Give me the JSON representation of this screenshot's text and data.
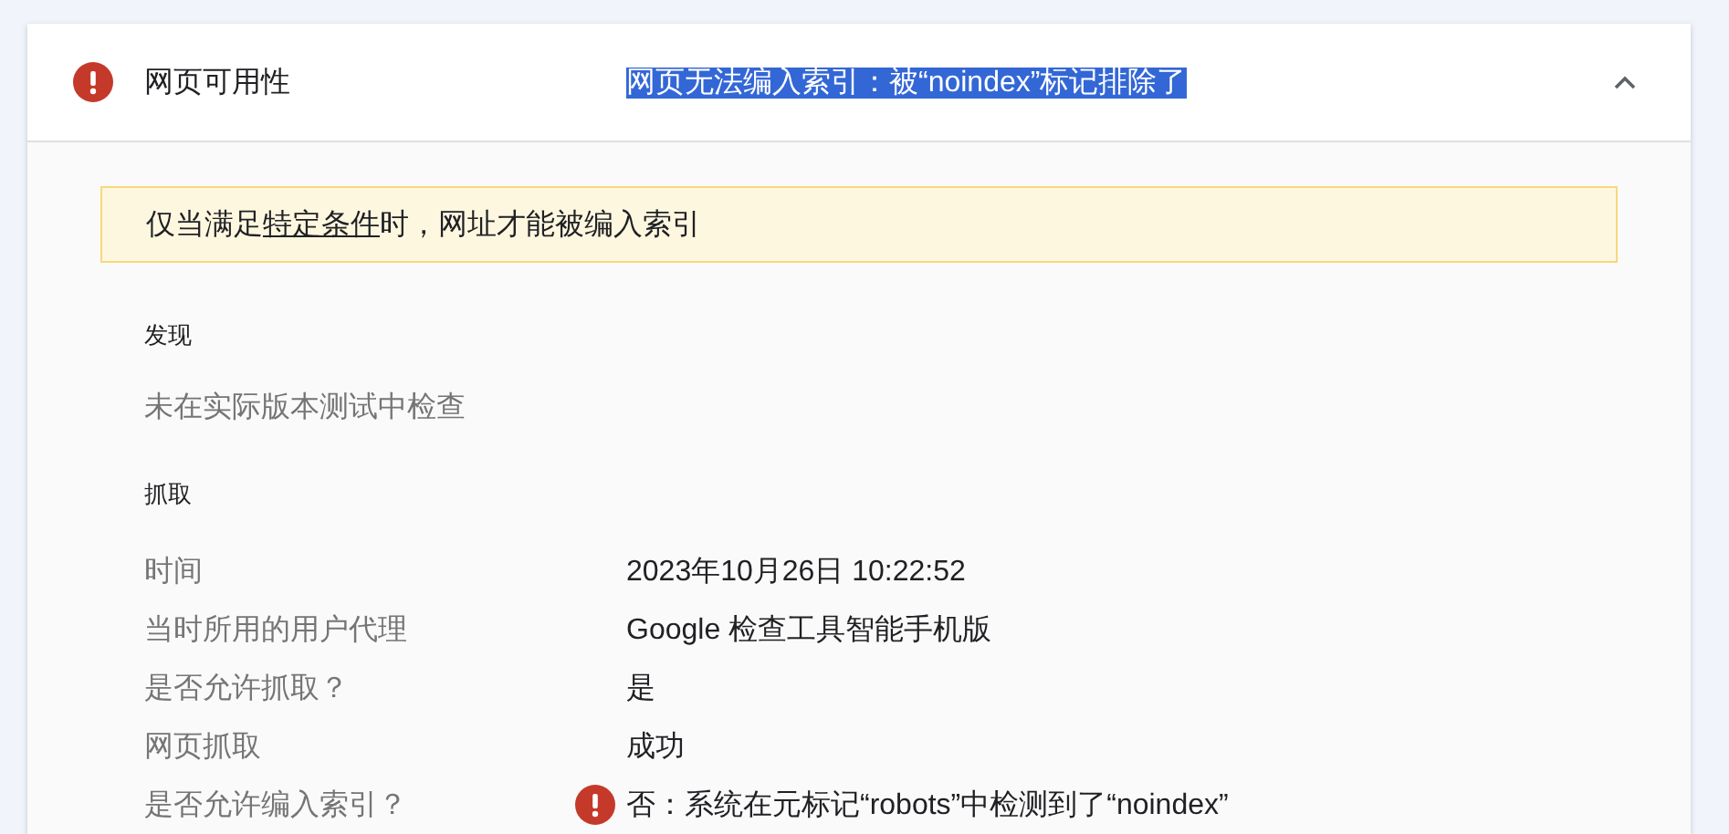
{
  "panel": {
    "title": "网页可用性",
    "error": true,
    "status": "网页无法编入索引：被“noindex”标记排除了",
    "status_selected": true,
    "expanded": true
  },
  "notice": {
    "before": "仅当满足",
    "link": "特定条件",
    "after": "时，网址才能被编入索引"
  },
  "discovery": {
    "heading": "发现",
    "text": "未在实际版本测试中检查"
  },
  "crawl": {
    "heading": "抓取",
    "rows": [
      {
        "label": "时间",
        "value": "2023年10月26日 10:22:52",
        "error": false
      },
      {
        "label": "当时所用的用户代理",
        "value": "Google 检查工具智能手机版",
        "error": false
      },
      {
        "label": "是否允许抓取？",
        "value": "是",
        "error": false
      },
      {
        "label": "网页抓取",
        "value": "成功",
        "error": false
      },
      {
        "label": "是否允许编入索引？",
        "value": "否：系统在元标记“robots”中检测到了“noindex”",
        "error": true
      }
    ]
  }
}
